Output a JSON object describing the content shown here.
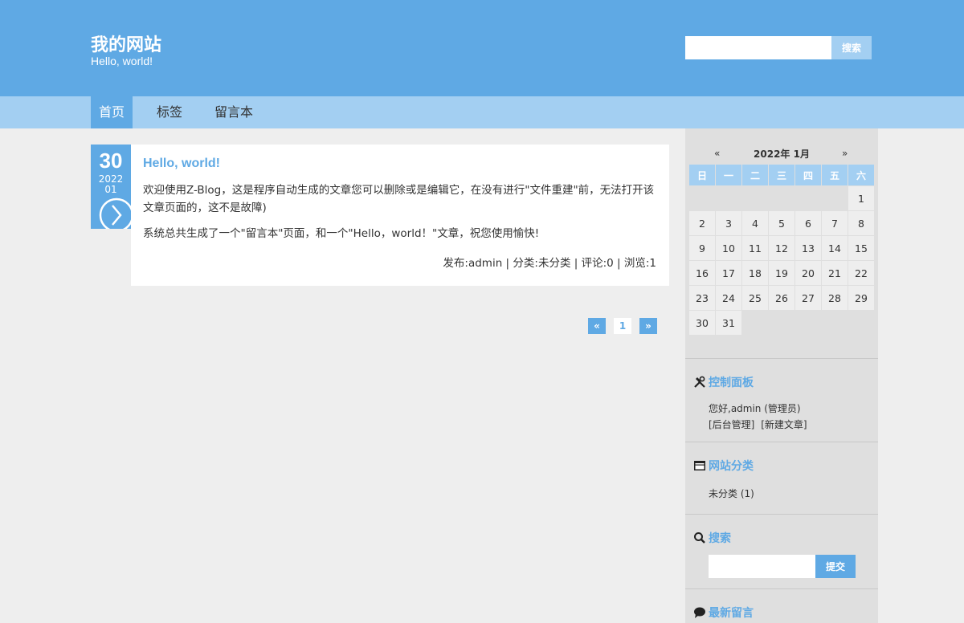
{
  "header": {
    "site_title": "我的网站",
    "site_subtitle": "Hello, world!",
    "search_placeholder": "",
    "search_button": "搜索"
  },
  "nav": {
    "items": [
      {
        "label": "首页",
        "active": true
      },
      {
        "label": "标签",
        "active": false
      },
      {
        "label": "留言本",
        "active": false
      }
    ]
  },
  "post": {
    "day": "30",
    "year": "2022",
    "month": "01",
    "title": "Hello, world!",
    "paragraph1": "欢迎使用Z-Blog，这是程序自动生成的文章您可以删除或是编辑它，在没有进行\"文件重建\"前，无法打开该文章页面的，这不是故障)",
    "paragraph2": "系统总共生成了一个\"留言本\"页面，和一个\"Hello，world！\"文章，祝您使用愉快!",
    "meta": "发布:admin | 分类:未分类 | 评论:0 | 浏览:1"
  },
  "pagination": {
    "prev": "«",
    "current": "1",
    "next": "»"
  },
  "calendar": {
    "prev": "«",
    "title": "2022年 1月",
    "next": "»",
    "weekdays": [
      "日",
      "一",
      "二",
      "三",
      "四",
      "五",
      "六"
    ],
    "first_weekday_index": 6,
    "days_in_month": 31
  },
  "control_panel": {
    "title": "控制面板",
    "greeting": "您好,admin (管理员)",
    "link_admin": "[后台管理]",
    "link_new": "[新建文章]"
  },
  "categories": {
    "title": "网站分类",
    "items": [
      "未分类 (1)"
    ]
  },
  "sidebar_search": {
    "title": "搜索",
    "placeholder": "",
    "button": "提交"
  },
  "recent_comments": {
    "title": "最新留言"
  },
  "colors": {
    "primary": "#5fa9e4",
    "light": "#a3cff2",
    "background": "#eeeeee",
    "sidebar": "#dfdfdf"
  }
}
